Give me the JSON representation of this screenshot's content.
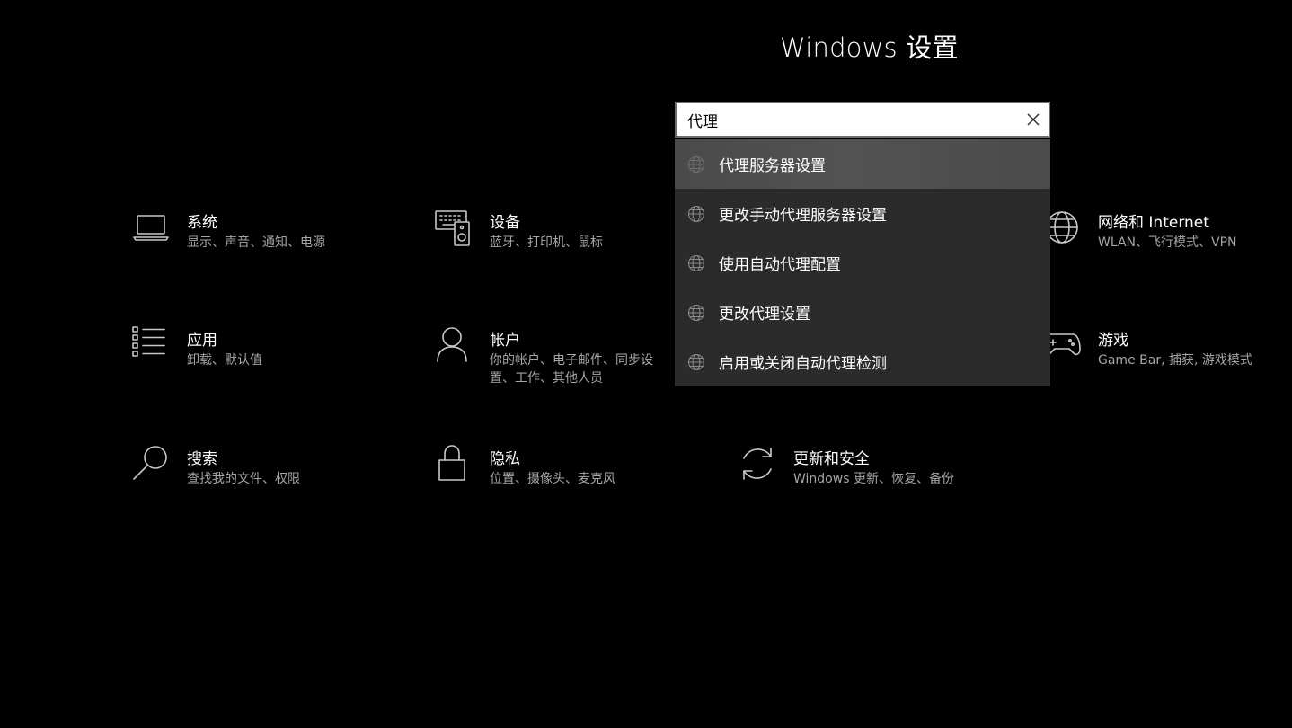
{
  "page": {
    "title": "Windows 设置"
  },
  "search": {
    "value": "代理",
    "clear_icon": "close-icon"
  },
  "suggestions": [
    {
      "label": "代理服务器设置",
      "icon": "globe-icon",
      "selected": true
    },
    {
      "label": "更改手动代理服务器设置",
      "icon": "globe-icon",
      "selected": false
    },
    {
      "label": "使用自动代理配置",
      "icon": "globe-icon",
      "selected": false
    },
    {
      "label": "更改代理设置",
      "icon": "globe-icon",
      "selected": false
    },
    {
      "label": "启用或关闭自动代理检测",
      "icon": "globe-icon",
      "selected": false
    }
  ],
  "categories": {
    "system": {
      "name": "系统",
      "desc": "显示、声音、通知、电源",
      "icon": "laptop-icon"
    },
    "devices": {
      "name": "设备",
      "desc": "蓝牙、打印机、鼠标",
      "icon": "keyboard-speaker-icon"
    },
    "network": {
      "name": "网络和 Internet",
      "desc": "WLAN、飞行模式、VPN",
      "icon": "globe-icon"
    },
    "apps": {
      "name": "应用",
      "desc": "卸载、默认值",
      "icon": "list-icon"
    },
    "accounts": {
      "name": "帐户",
      "desc": "你的帐户、电子邮件、同步设置、工作、其他人员",
      "icon": "person-icon"
    },
    "gaming": {
      "name": "游戏",
      "desc": "Game Bar, 捕获, 游戏模式",
      "icon": "gamepad-icon"
    },
    "search": {
      "name": "搜索",
      "desc": "查找我的文件、权限",
      "icon": "magnifier-icon"
    },
    "privacy": {
      "name": "隐私",
      "desc": "位置、摄像头、麦克风",
      "icon": "lock-icon"
    },
    "update": {
      "name": "更新和安全",
      "desc": "Windows 更新、恢复、备份",
      "icon": "sync-icon"
    }
  },
  "colors": {
    "background": "#000000",
    "dropdown_bg": "#2b2b2b",
    "selected_bg": "#4e4e4e",
    "desc_text": "#a6a6a6"
  }
}
